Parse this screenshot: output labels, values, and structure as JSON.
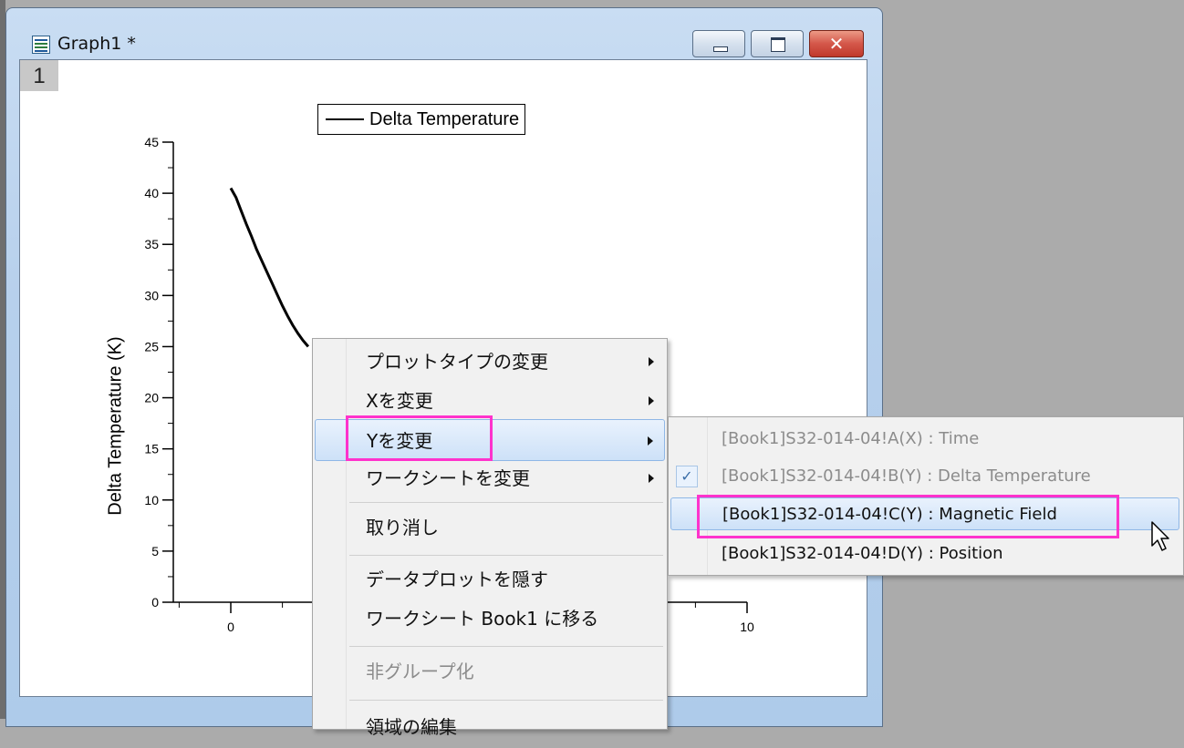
{
  "window": {
    "title": "Graph1 *",
    "layer_label": "1",
    "close_glyph": "✕",
    "buttons": [
      "minimize",
      "maximize",
      "close"
    ]
  },
  "chart_data": {
    "type": "line",
    "legend": [
      "Delta Temperature"
    ],
    "ylabel": "Delta Temperature (K)",
    "xlabel": "",
    "ylim": [
      0,
      45
    ],
    "xlim": [
      -1.2,
      10
    ],
    "yticks": [
      "0",
      "5",
      "10",
      "15",
      "20",
      "25",
      "30",
      "35",
      "40",
      "45"
    ],
    "xticks_visible": [
      "0",
      "10"
    ],
    "series": [
      {
        "name": "Delta Temperature",
        "x": [
          0,
          0.1,
          0.2,
          0.3,
          0.4,
          0.5,
          0.6,
          0.7,
          0.8,
          0.9,
          1.0,
          1.1,
          1.2,
          1.3,
          1.4,
          1.5
        ],
        "y": [
          40.5,
          39.6,
          38.3,
          37.0,
          35.8,
          34.5,
          33.4,
          32.3,
          31.2,
          30.1,
          29.0,
          28.0,
          27.1,
          26.3,
          25.6,
          25.0
        ]
      }
    ]
  },
  "context_menu": {
    "items": [
      {
        "label": "プロットタイプの変更",
        "submenu": true
      },
      {
        "label": "Xを変更",
        "submenu": true
      },
      {
        "label": "Yを変更",
        "submenu": true,
        "active": true
      },
      {
        "label": "ワークシートを変更",
        "submenu": true
      },
      {
        "label": "取り消し"
      },
      {
        "label": "データプロットを隠す"
      },
      {
        "label": "ワークシート Book1 に移る"
      },
      {
        "label": "非グループ化",
        "disabled": true
      },
      {
        "label": "領域の編集"
      }
    ]
  },
  "submenu": {
    "check_glyph": "✓",
    "items": [
      {
        "label": "[Book1]S32-014-04!A(X) : Time",
        "disabled": true
      },
      {
        "label": "[Book1]S32-014-04!B(Y) : Delta Temperature",
        "disabled": true,
        "checked": true
      },
      {
        "label": "[Book1]S32-014-04!C(Y) : Magnetic Field",
        "active": true
      },
      {
        "label": "[Book1]S32-014-04!D(Y) : Position"
      }
    ]
  },
  "highlight_color": "#ff33cc"
}
